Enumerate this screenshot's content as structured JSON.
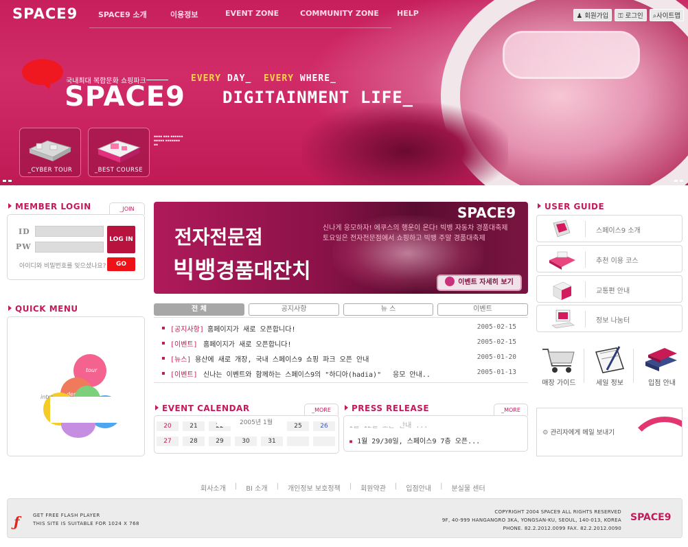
{
  "header": {
    "logo": "SPACE9",
    "nav": [
      "SPACE9 소개",
      "이용정보",
      "EVENT ZONE",
      "COMMUNITY ZONE",
      "HELP"
    ],
    "util": [
      "회원가입",
      "로그인",
      "사이트맵"
    ],
    "tagline": "국내최대 복합문화 쇼핑파크",
    "big_logo": "SPACE9",
    "every_day_a": "EVERY DAY_",
    "every_day_b": "EVERY",
    "every_day_c": "WHERE_",
    "digit": "DIGITAINMENT LIFE_",
    "tour_cyber": "_CYBER TOUR",
    "tour_best": "_BEST COURSE"
  },
  "login": {
    "title": "MEMBER LOGIN",
    "join": "_JOIN",
    "id_label": "ID",
    "pw_label": "PW",
    "login_btn": "LOG IN",
    "forgot": "아이디와 비밀번호를 잊으셨나요?",
    "go_btn": "GO"
  },
  "quick": {
    "title": "QUICK MENU",
    "balls": [
      "tour",
      "desk",
      "intro"
    ]
  },
  "banner": {
    "title1": "전자전문점",
    "title2a": "빅뱅",
    "title2b": "경품대잔치",
    "logo": "SPACE9",
    "desc1": "신나게 응모하자! 에쿠스의 행운이 온다! 빅뱅 자동차 경품대축제",
    "desc2": "토요일은 전자전문점에서 쇼핑하고 빅뱅 주말 경품대축제",
    "button": "이벤트 자세히 보기"
  },
  "tabs": [
    "전 체",
    "공지사항",
    "뉴 스",
    "이벤트"
  ],
  "news": [
    {
      "cat": "[공지사항]",
      "title": "홈페이지가 새로 오픈합니다!",
      "date": "2005-02-15"
    },
    {
      "cat": "[이벤트]",
      "title": "홈페이지가 새로 오픈합니다!",
      "date": "2005-02-15"
    },
    {
      "cat": "[뉴스]",
      "title": "용산에 새로 개장, 국내 스페이스9 쇼핑 파크 오픈 안내",
      "date": "2005-01-20"
    },
    {
      "cat": "[이벤트]",
      "title": "신나는 이벤트와 함께하는 스페이스9의 \"하디아(hadia)\"",
      "date": "2005-01-13",
      "extra": "응모 안내.."
    }
  ],
  "calendar": {
    "title": "EVENT CALENDAR",
    "more": "_MORE",
    "row1": [
      "20",
      "21",
      "22",
      "",
      "",
      "25",
      "26"
    ],
    "overlay": "2005년 1월",
    "row2": [
      "27",
      "28",
      "29",
      "30",
      "31",
      "",
      ""
    ]
  },
  "press": {
    "title": "PRESS RELEASE",
    "more": "_MORE",
    "item1": "1월 12일 오픈 안내 ...",
    "item2": "1월 29/30일, 스페이스9 7층 오픈..."
  },
  "guide": {
    "title": "USER GUIDE",
    "items": [
      "스페이스9 소개",
      "추천 이용 코스",
      "교통편 안내",
      "정보 나눔터"
    ],
    "icons": [
      "매장 가이드",
      "세일 정보",
      "입점 안내"
    ],
    "admin": "관리자에게 메일 보내기"
  },
  "footer": {
    "links": [
      "회사소개",
      "BI 소개",
      "개인정보 보호정책",
      "회원약관",
      "입점안내",
      "분실물 센터"
    ],
    "left1": "GET FREE FLASH PLAYER",
    "left2": "THIS SITE IS SUITABLE FOR 1024 X 768",
    "right1": "COPYRIGHT 2004 SPACE9 ALL RIGHTS RESERVED",
    "right2": "9F, 40-999 HANGANGRO 3KA, YONGSAN-KU, SEOUL, 140-013, KOREA",
    "right3": "PHONE. 82.2.2012.0099     FAX. 82.2.2012.0090",
    "logo": "SPACE9"
  },
  "colors": {
    "brand": "#c4195a",
    "accent": "#ee1118",
    "header": "#c61f5c"
  }
}
